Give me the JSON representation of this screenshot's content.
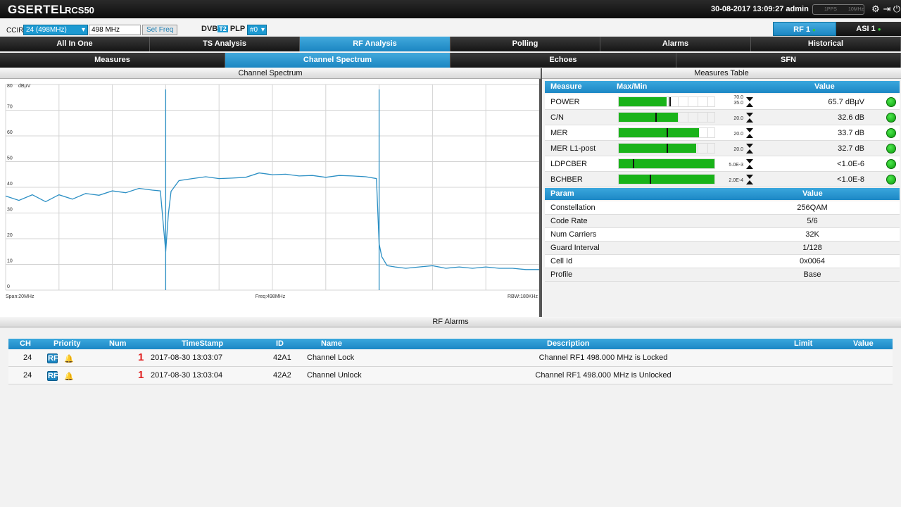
{
  "header": {
    "brand": "GSERTEL",
    "model": "RCS50",
    "datetime": "30-08-2017 13:09:27 admin",
    "sync_labels": [
      "1PPS",
      "10MHz"
    ],
    "icons": [
      "gear-icon",
      "logout-icon",
      "power-icon"
    ]
  },
  "controls": {
    "ccir_label": "CCIR",
    "channel_select": "24 (498MHz)",
    "freq_value": "498 MHz",
    "set_freq": "Set Freq",
    "dvb_label": "DVB",
    "dvb_t2": "T2",
    "plp_label": "PLP",
    "plp_select": "#0",
    "rf_tab": "RF 1",
    "asi_tab": "ASI 1"
  },
  "main_tabs": [
    "All In One",
    "TS Analysis",
    "RF Analysis",
    "Polling",
    "Alarms",
    "Historical"
  ],
  "main_tab_active": "RF Analysis",
  "sub_tabs": [
    "Measures",
    "Channel Spectrum",
    "Echoes",
    "SFN"
  ],
  "sub_tab_active": "Channel Spectrum",
  "spectrum": {
    "title": "Channel Spectrum",
    "span_label": "Span:20MHz",
    "freq_label": "Freq:498MHz",
    "rbw_label": "RBW:180KHz"
  },
  "chart_data": {
    "type": "line",
    "title": "Channel Spectrum",
    "ylabel": "dBµV",
    "ylim": [
      0,
      80
    ],
    "yticks": [
      "0",
      "10",
      "20",
      "30",
      "40",
      "50",
      "60",
      "70",
      "80"
    ],
    "y_unit_label": "dBµV",
    "xlim": [
      488,
      508
    ],
    "x_markers": [
      494.0,
      502.0
    ],
    "grid": true,
    "series": [
      {
        "x": [
          488,
          488.5,
          489,
          489.5,
          490,
          490.5,
          491,
          491.5,
          492,
          492.5,
          493,
          493.5,
          493.8,
          494.0,
          494.1,
          494.2,
          494.5,
          495,
          495.5,
          496,
          496.5,
          497,
          497.5,
          498,
          498.5,
          499,
          499.5,
          500,
          500.5,
          501,
          501.5,
          501.9,
          502.0,
          502.1,
          502.3,
          502.6,
          503,
          503.5,
          504,
          504.5,
          505,
          505.5,
          506,
          506.5,
          507,
          507.5,
          508
        ],
        "values": [
          36,
          35.5,
          36.5,
          35,
          36.5,
          36,
          37,
          37.5,
          38,
          38.5,
          39,
          39.5,
          38,
          15,
          29,
          39,
          42,
          44,
          43.5,
          44,
          43,
          44.5,
          45,
          45.5,
          44.5,
          45,
          44,
          44.5,
          44,
          45,
          43.5,
          44,
          18,
          13,
          9.5,
          9,
          8.5,
          9,
          9.5,
          8.5,
          9,
          8.5,
          9,
          8.5,
          8.5,
          8,
          8
        ]
      }
    ]
  },
  "measures": {
    "title": "Measures Table",
    "headers": [
      "Measure",
      "Max/Min",
      "Value"
    ],
    "rows": [
      {
        "name": "POWER",
        "fill": 0.5,
        "mark": 0.53,
        "lim_top": "70.0",
        "lim_bot": "35.0",
        "value": "65.7 dBµV"
      },
      {
        "name": "C/N",
        "fill": 0.62,
        "mark": 0.38,
        "lim_top": "",
        "lim_bot": "20.0",
        "value": "32.6 dB"
      },
      {
        "name": "MER",
        "fill": 0.84,
        "mark": 0.5,
        "lim_top": "",
        "lim_bot": "20.0",
        "value": "33.7 dB"
      },
      {
        "name": "MER L1-post",
        "fill": 0.81,
        "mark": 0.5,
        "lim_top": "",
        "lim_bot": "20.0",
        "value": "32.7 dB"
      },
      {
        "name": "LDPCBER",
        "fill": 1.0,
        "mark": 0.15,
        "lim_top": "",
        "lim_bot": "5.0E-3",
        "value": "<1.0E-6"
      },
      {
        "name": "BCHBER",
        "fill": 1.0,
        "mark": 0.32,
        "lim_top": "",
        "lim_bot": "2.0E-4",
        "value": "<1.0E-8"
      }
    ],
    "param_headers": [
      "Param",
      "Value"
    ],
    "params": [
      {
        "name": "Constellation",
        "value": "256QAM"
      },
      {
        "name": "Code Rate",
        "value": "5/6"
      },
      {
        "name": "Num Carriers",
        "value": "32K"
      },
      {
        "name": "Guard Interval",
        "value": "1/128"
      },
      {
        "name": "Cell Id",
        "value": "0x0064"
      },
      {
        "name": "Profile",
        "value": "Base"
      }
    ]
  },
  "alarms": {
    "title": "RF Alarms",
    "headers": [
      "CH",
      "Priority",
      "Num",
      "TimeStamp",
      "ID",
      "Name",
      "Description",
      "Limit",
      "Value"
    ],
    "rf_badge": "RF",
    "rows": [
      {
        "ch": "24",
        "num": "1",
        "timestamp": "2017-08-30 13:03:07",
        "id": "42A1",
        "name": "Channel Lock",
        "description": "Channel RF1 498.000 MHz is Locked"
      },
      {
        "ch": "24",
        "num": "1",
        "timestamp": "2017-08-30 13:03:04",
        "id": "42A2",
        "name": "Channel Unlock",
        "description": "Channel RF1 498.000 MHz is Unlocked"
      }
    ]
  },
  "colors": {
    "accent": "#1d9ad2",
    "trace": "#2b8fc4",
    "meter_fill": "#19b319",
    "alarm_num": "#e02020"
  }
}
